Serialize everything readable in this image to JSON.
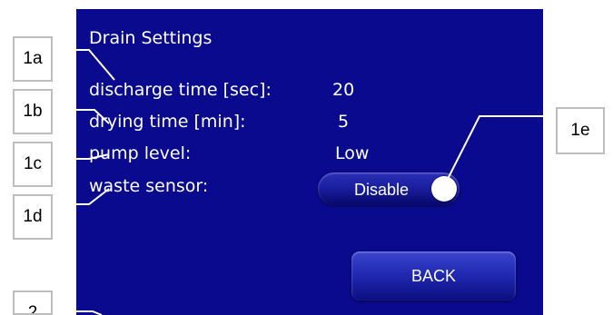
{
  "screen": {
    "title": "Drain Settings",
    "rows": [
      {
        "label": "discharge time [sec]:",
        "value": "20"
      },
      {
        "label": "drying time [min]:",
        "value": "5"
      },
      {
        "label": "pump level:",
        "value": "Low"
      },
      {
        "label": "waste sensor:",
        "value": ""
      }
    ],
    "waste_sensor_toggle": {
      "label": "Disable"
    },
    "back_label": "BACK",
    "colors": {
      "background": "#0a0a8f",
      "text": "#ffffff"
    }
  },
  "callouts": [
    "1a",
    "1b",
    "1c",
    "1d",
    "1e",
    "2"
  ]
}
